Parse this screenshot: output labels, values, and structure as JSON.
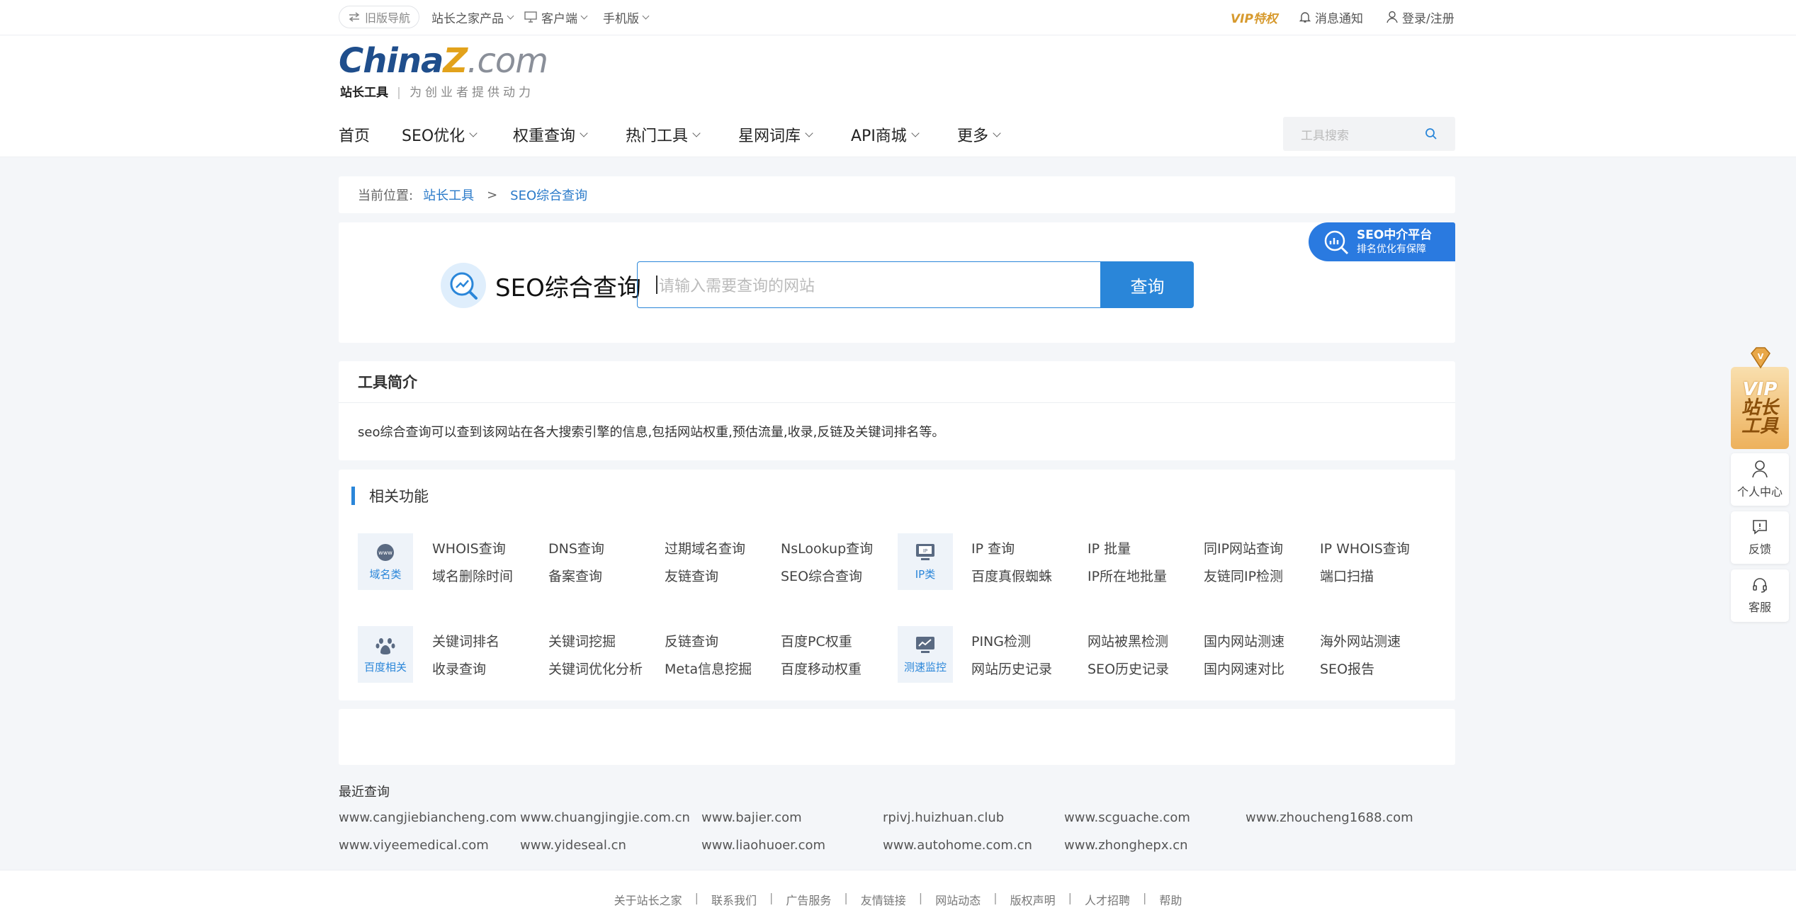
{
  "topbar": {
    "old_nav": "旧版导航",
    "products": "站长之家产品",
    "client": "客户端",
    "mobile": "手机版",
    "vip": "VIP特权",
    "notify": "消息通知",
    "login": "登录/注册"
  },
  "logo": {
    "part1": "China",
    "part2": "Z",
    "part3": ".com",
    "sub": "站长工具",
    "slogan": "为创业者提供动力"
  },
  "nav": {
    "items": [
      "首页",
      "SEO优化",
      "权重查询",
      "热门工具",
      "星网词库",
      "API商城",
      "更多"
    ],
    "search_placeholder": "工具搜索"
  },
  "breadcrumb": {
    "prefix": "当前位置:",
    "home": "站长工具",
    "sep": ">",
    "current": "SEO综合查询"
  },
  "query": {
    "title": "SEO综合查询",
    "placeholder": "请输入需要查询的网站",
    "button": "查询",
    "badge_title": "SEO中介平台",
    "badge_sub": "排名优化有保障"
  },
  "intro": {
    "title": "工具简介",
    "text": "seo综合查询可以查到该网站在各大搜索引擎的信息,包括网站权重,预估流量,收录,反链及关键词排名等。"
  },
  "functions": {
    "title": "相关功能",
    "groups": [
      {
        "name": "域名类",
        "links": [
          "WHOIS查询",
          "DNS查询",
          "过期域名查询",
          "NsLookup查询",
          "域名删除时间",
          "备案查询",
          "友链查询",
          "SEO综合查询"
        ]
      },
      {
        "name": "IP类",
        "links": [
          "IP 查询",
          "IP 批量",
          "同IP网站查询",
          "IP WHOIS查询",
          "百度真假蜘蛛",
          "IP所在地批量",
          "友链同IP检测",
          "端口扫描"
        ]
      },
      {
        "name": "百度相关",
        "links": [
          "关键词排名",
          "关键词挖掘",
          "反链查询",
          "百度PC权重",
          "收录查询",
          "关键词优化分析",
          "Meta信息挖掘",
          "百度移动权重"
        ]
      },
      {
        "name": "测速监控",
        "links": [
          "PING检测",
          "网站被黑检测",
          "国内网站测速",
          "海外网站测速",
          "网站历史记录",
          "SEO历史记录",
          "国内网速对比",
          "SEO报告"
        ]
      }
    ]
  },
  "recent": {
    "title": "最近查询",
    "items": [
      "www.cangjiebiancheng.com",
      "www.chuangjingjie.com.cn",
      "www.bajier.com",
      "rpivj.huizhuan.club",
      "www.scguache.com",
      "www.zhoucheng1688.com",
      "www.viyeemedical.com",
      "www.yideseal.cn",
      "www.liaohuoer.com",
      "www.autohome.com.cn",
      "www.zhonghepx.cn"
    ]
  },
  "footer": {
    "links": [
      "关于站长之家",
      "联系我们",
      "广告服务",
      "友情链接",
      "网站动态",
      "版权声明",
      "人才招聘",
      "帮助"
    ],
    "sep": "|"
  },
  "float": {
    "vip_line1": "VIP",
    "vip_line2": "站长",
    "vip_line3": "工具",
    "personal": "个人中心",
    "feedback": "反馈",
    "service": "客服"
  },
  "colors": {
    "accent": "#2a86d9",
    "link": "#2a7ac9",
    "vip": "#d79a2e",
    "logo_blue": "#1f4e8c"
  }
}
